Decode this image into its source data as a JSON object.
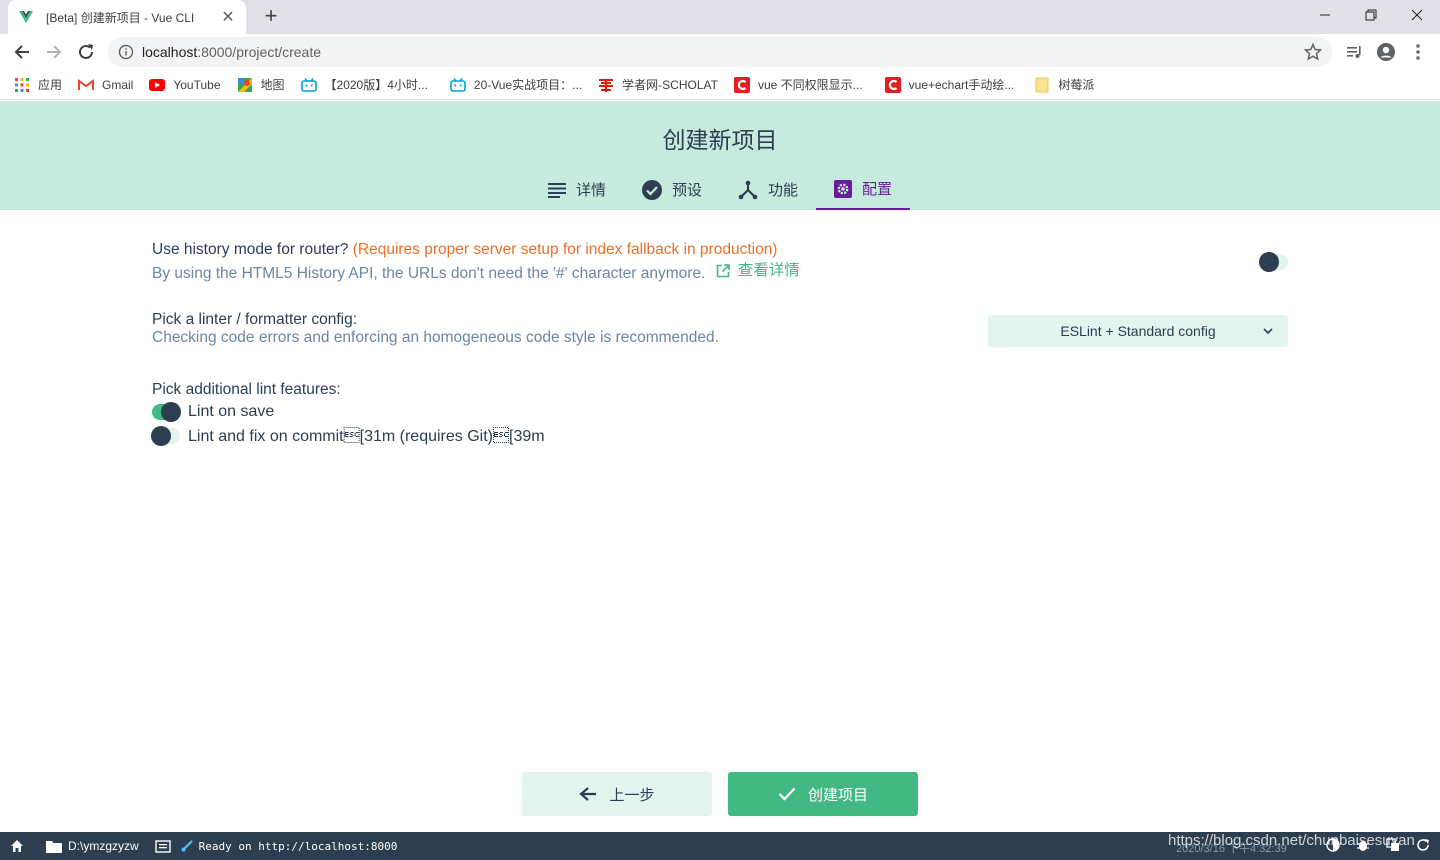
{
  "browser": {
    "tab_title": "[Beta] 创建新项目 - Vue CLI",
    "tab_close": "✕",
    "new_tab": "+",
    "url_host": "localhost",
    "url_rest": ":8000/project/create",
    "bookmarks": [
      {
        "label": "应用",
        "icon": "apps-grid-icon"
      },
      {
        "label": "Gmail",
        "icon": "gmail-icon"
      },
      {
        "label": "YouTube",
        "icon": "youtube-icon"
      },
      {
        "label": "地图",
        "icon": "maps-icon"
      },
      {
        "label": "【2020版】4小时...",
        "icon": "bilibili-icon"
      },
      {
        "label": "20-Vue实战项目：...",
        "icon": "bilibili-icon"
      },
      {
        "label": "学者网-SCHOLAT",
        "icon": "scholat-icon"
      },
      {
        "label": "vue 不同权限显示...",
        "icon": "csdn-icon"
      },
      {
        "label": "vue+echart手动绘...",
        "icon": "csdn-icon"
      },
      {
        "label": "树莓派",
        "icon": "folder-icon"
      }
    ]
  },
  "header": {
    "title": "创建新项目",
    "steps": [
      {
        "label": "详情",
        "icon": "list-icon"
      },
      {
        "label": "预设",
        "icon": "check-circle-icon"
      },
      {
        "label": "功能",
        "icon": "merge-icon"
      },
      {
        "label": "配置",
        "icon": "settings-icon"
      }
    ]
  },
  "config": {
    "router": {
      "prompt": "Use history mode for router?",
      "warning": "(Requires proper server setup for index fallback in production)",
      "description": "By using the HTML5 History API, the URLs don't need the '#' character anymore.",
      "more_link": "查看详情",
      "enabled": false
    },
    "linter": {
      "prompt": "Pick a linter / formatter config:",
      "description": "Checking code errors and enforcing an homogeneous code style is recommended.",
      "selected": "ESLint + Standard config"
    },
    "lint_features": {
      "prompt": "Pick additional lint features:",
      "options": [
        {
          "label": "Lint on save",
          "enabled": true
        },
        {
          "label": "Lint and fix on commit\u001b[31m (requires Git)\u001b[39m",
          "enabled": false
        }
      ]
    }
  },
  "footer": {
    "prev_label": "上一步",
    "create_label": "创建项目"
  },
  "statusbar": {
    "folder": "D:\\ymzgzyzw",
    "log": "Ready on http://localhost:8000",
    "time": "2020/3/16 下午4:32:39",
    "watermark": "https://blog.csdn.net/chunbaisesuyan"
  },
  "colors": {
    "accent_green": "#42b983",
    "header_bg": "#c6eade",
    "active_step": "#6a1b9a",
    "warning": "#e8702a",
    "statusbar_bg": "#2c3e50"
  }
}
